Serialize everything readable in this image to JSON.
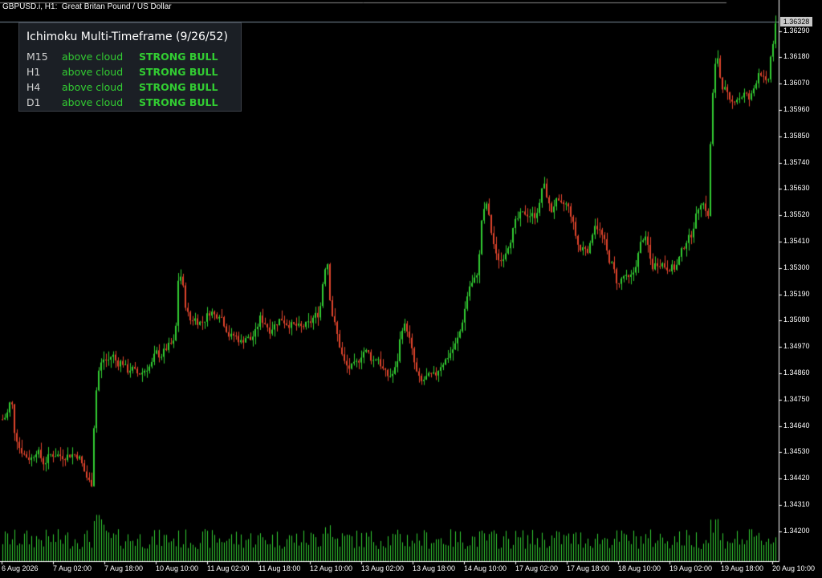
{
  "chart_title": "GBPUSD.i, H1:  Great Britan Pound / US Dollar",
  "current_price": "1.36328",
  "info_panel": {
    "title": "Ichimoku Multi-Timeframe (9/26/52)",
    "rows": [
      {
        "tf": "M15",
        "position": "above cloud",
        "signal": "STRONG BULL"
      },
      {
        "tf": "H1",
        "position": "above cloud",
        "signal": "STRONG BULL"
      },
      {
        "tf": "H4",
        "position": "above cloud",
        "signal": "STRONG BULL"
      },
      {
        "tf": "D1",
        "position": "above cloud",
        "signal": "STRONG BULL"
      }
    ]
  },
  "price_axis": [
    "1.36290",
    "1.36180",
    "1.36070",
    "1.35960",
    "1.35850",
    "1.35740",
    "1.35630",
    "1.35520",
    "1.35410",
    "1.35300",
    "1.35190",
    "1.35080",
    "1.34970",
    "1.34860",
    "1.34750",
    "1.34640",
    "1.34530",
    "1.34420",
    "1.34310",
    "1.34200"
  ],
  "time_axis": [
    "6 Aug 2026",
    "7 Aug 02:00",
    "7 Aug 18:00",
    "10 Aug 10:00",
    "11 Aug 02:00",
    "11 Aug 18:00",
    "12 Aug 10:00",
    "13 Aug 02:00",
    "13 Aug 18:00",
    "14 Aug 10:00",
    "17 Aug 02:00",
    "17 Aug 18:00",
    "18 Aug 10:00",
    "19 Aug 02:00",
    "19 Aug 18:00",
    "20 Aug 10:00"
  ],
  "colors": {
    "bull": "#32cd32",
    "bear": "#e0442c",
    "volume": "#32cd32",
    "background": "#000000",
    "axis": "#ffffff"
  },
  "chart_data": {
    "type": "candlestick",
    "symbol": "GBPUSD.i",
    "timeframe": "H1",
    "ylim": [
      1.3415,
      1.3637
    ],
    "close_path": [
      [
        0,
        1.3466
      ],
      [
        8,
        1.3468
      ],
      [
        14,
        1.3476
      ],
      [
        18,
        1.3462
      ],
      [
        24,
        1.3455
      ],
      [
        30,
        1.3452
      ],
      [
        38,
        1.345
      ],
      [
        46,
        1.3454
      ],
      [
        55,
        1.3448
      ],
      [
        62,
        1.3452
      ],
      [
        70,
        1.3452
      ],
      [
        80,
        1.3451
      ],
      [
        88,
        1.3452
      ],
      [
        95,
        1.3452
      ],
      [
        100,
        1.345
      ],
      [
        106,
        1.3444
      ],
      [
        110,
        1.3441
      ],
      [
        114,
        1.344
      ],
      [
        118,
        1.3472
      ],
      [
        122,
        1.3486
      ],
      [
        128,
        1.3492
      ],
      [
        134,
        1.3491
      ],
      [
        140,
        1.3494
      ],
      [
        146,
        1.349
      ],
      [
        152,
        1.3491
      ],
      [
        158,
        1.3487
      ],
      [
        164,
        1.3488
      ],
      [
        170,
        1.3486
      ],
      [
        176,
        1.3486
      ],
      [
        182,
        1.3488
      ],
      [
        188,
        1.3489
      ],
      [
        194,
        1.3495
      ],
      [
        200,
        1.3493
      ],
      [
        206,
        1.3496
      ],
      [
        212,
        1.3498
      ],
      [
        218,
        1.3499
      ],
      [
        222,
        1.3525
      ],
      [
        226,
        1.3527
      ],
      [
        230,
        1.3516
      ],
      [
        236,
        1.3508
      ],
      [
        242,
        1.3509
      ],
      [
        248,
        1.3507
      ],
      [
        254,
        1.3508
      ],
      [
        262,
        1.3512
      ],
      [
        268,
        1.351
      ],
      [
        274,
        1.3511
      ],
      [
        280,
        1.3506
      ],
      [
        286,
        1.3501
      ],
      [
        292,
        1.3502
      ],
      [
        300,
        1.3499
      ],
      [
        306,
        1.3501
      ],
      [
        312,
        1.35
      ],
      [
        318,
        1.3503
      ],
      [
        324,
        1.3509
      ],
      [
        330,
        1.3507
      ],
      [
        336,
        1.3504
      ],
      [
        342,
        1.3506
      ],
      [
        350,
        1.3509
      ],
      [
        356,
        1.3507
      ],
      [
        362,
        1.3506
      ],
      [
        368,
        1.3506
      ],
      [
        374,
        1.3505
      ],
      [
        380,
        1.3506
      ],
      [
        386,
        1.3507
      ],
      [
        392,
        1.351
      ],
      [
        398,
        1.3511
      ],
      [
        404,
        1.353
      ],
      [
        408,
        1.3532
      ],
      [
        412,
        1.3513
      ],
      [
        418,
        1.3505
      ],
      [
        424,
        1.3496
      ],
      [
        428,
        1.3491
      ],
      [
        434,
        1.3488
      ],
      [
        440,
        1.3489
      ],
      [
        446,
        1.3491
      ],
      [
        452,
        1.3495
      ],
      [
        458,
        1.3495
      ],
      [
        464,
        1.3491
      ],
      [
        470,
        1.3493
      ],
      [
        476,
        1.3488
      ],
      [
        482,
        1.3485
      ],
      [
        488,
        1.3485
      ],
      [
        494,
        1.3489
      ],
      [
        500,
        1.3505
      ],
      [
        506,
        1.3506
      ],
      [
        512,
        1.3497
      ],
      [
        518,
        1.3487
      ],
      [
        524,
        1.3482
      ],
      [
        530,
        1.3484
      ],
      [
        536,
        1.3485
      ],
      [
        542,
        1.3485
      ],
      [
        548,
        1.3489
      ],
      [
        554,
        1.3491
      ],
      [
        560,
        1.3494
      ],
      [
        566,
        1.3497
      ],
      [
        572,
        1.3502
      ],
      [
        578,
        1.3511
      ],
      [
        584,
        1.3522
      ],
      [
        590,
        1.3524
      ],
      [
        596,
        1.353
      ],
      [
        600,
        1.355
      ],
      [
        606,
        1.3557
      ],
      [
        612,
        1.3545
      ],
      [
        618,
        1.3535
      ],
      [
        624,
        1.3533
      ],
      [
        630,
        1.3537
      ],
      [
        636,
        1.3542
      ],
      [
        642,
        1.3549
      ],
      [
        648,
        1.3552
      ],
      [
        654,
        1.3553
      ],
      [
        660,
        1.3552
      ],
      [
        666,
        1.3552
      ],
      [
        672,
        1.3556
      ],
      [
        676,
        1.3566
      ],
      [
        680,
        1.3562
      ],
      [
        686,
        1.3553
      ],
      [
        692,
        1.3558
      ],
      [
        698,
        1.3556
      ],
      [
        704,
        1.3557
      ],
      [
        710,
        1.3554
      ],
      [
        716,
        1.3545
      ],
      [
        722,
        1.3537
      ],
      [
        728,
        1.3539
      ],
      [
        734,
        1.3537
      ],
      [
        740,
        1.3549
      ],
      [
        746,
        1.3546
      ],
      [
        752,
        1.3542
      ],
      [
        758,
        1.3534
      ],
      [
        764,
        1.353
      ],
      [
        770,
        1.3522
      ],
      [
        776,
        1.3527
      ],
      [
        782,
        1.3525
      ],
      [
        788,
        1.3527
      ],
      [
        794,
        1.3534
      ],
      [
        800,
        1.3543
      ],
      [
        806,
        1.3541
      ],
      [
        812,
        1.353
      ],
      [
        818,
        1.3532
      ],
      [
        824,
        1.3532
      ],
      [
        830,
        1.353
      ],
      [
        836,
        1.353
      ],
      [
        842,
        1.353
      ],
      [
        848,
        1.3536
      ],
      [
        854,
        1.3541
      ],
      [
        860,
        1.3543
      ],
      [
        866,
        1.355
      ],
      [
        872,
        1.3558
      ],
      [
        878,
        1.3556
      ],
      [
        882,
        1.3551
      ],
      [
        886,
        1.3592
      ],
      [
        890,
        1.3613
      ],
      [
        894,
        1.3618
      ],
      [
        898,
        1.3607
      ],
      [
        904,
        1.3604
      ],
      [
        910,
        1.3598
      ],
      [
        916,
        1.3601
      ],
      [
        922,
        1.3601
      ],
      [
        928,
        1.3603
      ],
      [
        934,
        1.36
      ],
      [
        940,
        1.3606
      ],
      [
        946,
        1.3613
      ],
      [
        952,
        1.3608
      ],
      [
        956,
        1.3606
      ],
      [
        960,
        1.3618
      ],
      [
        964,
        1.3626
      ],
      [
        967,
        1.3633
      ]
    ],
    "volume_note": "volume histogram bars along bottom"
  }
}
